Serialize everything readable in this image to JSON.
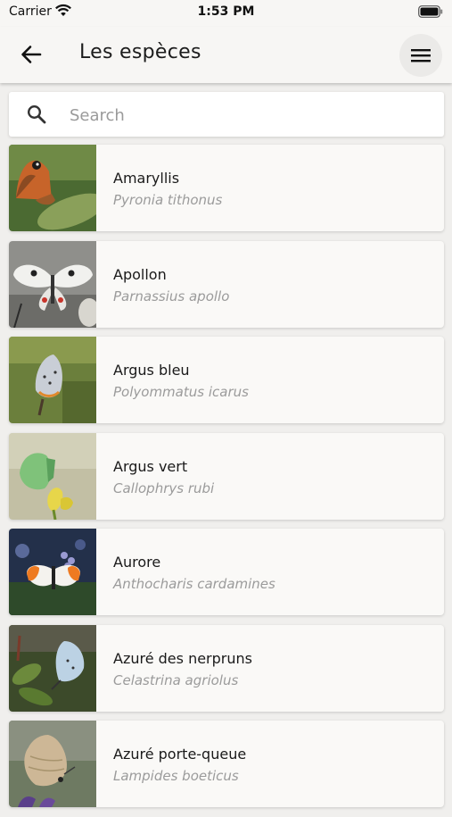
{
  "status": {
    "carrier": "Carrier",
    "time": "1:53 PM"
  },
  "header": {
    "title": "Les espèces"
  },
  "search": {
    "placeholder": "Search"
  },
  "species": [
    {
      "name": "Amaryllis",
      "latin": "Pyronia tithonus",
      "thumb_colors": [
        "#3f5a2c",
        "#c7642a",
        "#8aa05a"
      ]
    },
    {
      "name": "Apollon",
      "latin": "Parnassius apollo",
      "thumb_colors": [
        "#9a9a96",
        "#f1f1ee",
        "#333333"
      ]
    },
    {
      "name": "Argus bleu",
      "latin": "Polyommatus icarus",
      "thumb_colors": [
        "#6b7f3c",
        "#c9ced6",
        "#a7b56a"
      ]
    },
    {
      "name": "Argus vert",
      "latin": "Callophrys rubi",
      "thumb_colors": [
        "#c2bfa4",
        "#7fc27a",
        "#e7d64a"
      ]
    },
    {
      "name": "Aurore",
      "latin": "Anthocharis cardamines",
      "thumb_colors": [
        "#23304a",
        "#f4f2ee",
        "#ee7a21"
      ]
    },
    {
      "name": "Azuré des nerpruns",
      "latin": "Celastrina agriolus",
      "thumb_colors": [
        "#3c4a2a",
        "#bcd2e4",
        "#6c8a3c"
      ]
    },
    {
      "name": "Azuré porte-queue",
      "latin": "Lampides boeticus",
      "thumb_colors": [
        "#6e7a62",
        "#cdb796",
        "#5a3f8a"
      ]
    }
  ]
}
